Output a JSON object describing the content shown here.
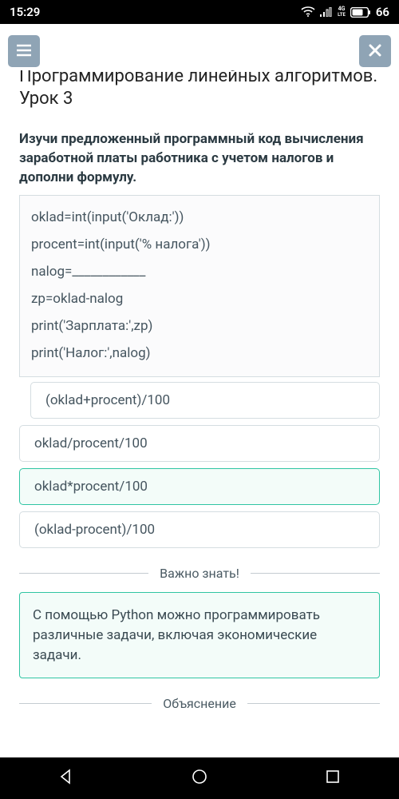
{
  "status": {
    "time": "15:29",
    "network_label": "4G LTE",
    "battery": "66"
  },
  "lesson": {
    "title": "Программирование линейных алгоритмов. Урок 3",
    "prompt": "Изучи предложенный программный код вычисления заработной платы работника с учетом налогов и дополни формулу.",
    "code": {
      "l1": "oklad=int(input('Оклад:'))",
      "l2": "procent=int(input('% налога'))",
      "l3": "nalog=____________",
      "l4": "zp=oklad-nalog",
      "l5": "print('Зарплата:',zp)",
      "l6": "print('Налог:',nalog)"
    },
    "options": {
      "o1": "(oklad+procent)/100",
      "o2": "oklad/procent/100",
      "o3": "oklad*procent/100",
      "o4": "(oklad-procent)/100"
    },
    "important_header": "Важно знать!",
    "important_body": "С помощью Python можно программировать различные задачи, включая экономические задачи.",
    "explanation_header": "Объяснение"
  }
}
